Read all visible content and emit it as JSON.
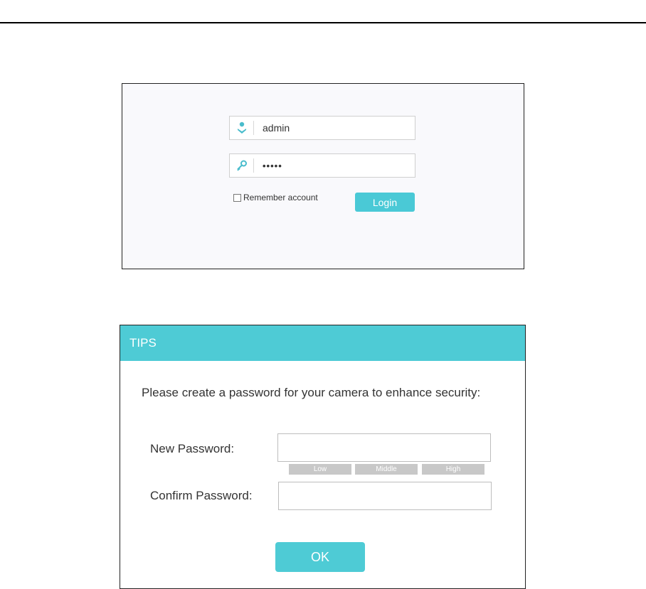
{
  "login": {
    "username_value": "admin",
    "username_icon": "user-icon",
    "password_value": "•••••",
    "password_icon": "key-icon",
    "remember_label": "Remember account",
    "remember_checked": false,
    "login_label": "Login",
    "accent_color": "#4ac9d6"
  },
  "tips": {
    "title": "TIPS",
    "message": "Please create a password for your camera to enhance security:",
    "new_password_label": "New Password:",
    "confirm_password_label": "Confirm Password:",
    "strength_levels": [
      "Low",
      "Middle",
      "High"
    ],
    "ok_label": "OK",
    "header_color": "#4ecbd5"
  }
}
